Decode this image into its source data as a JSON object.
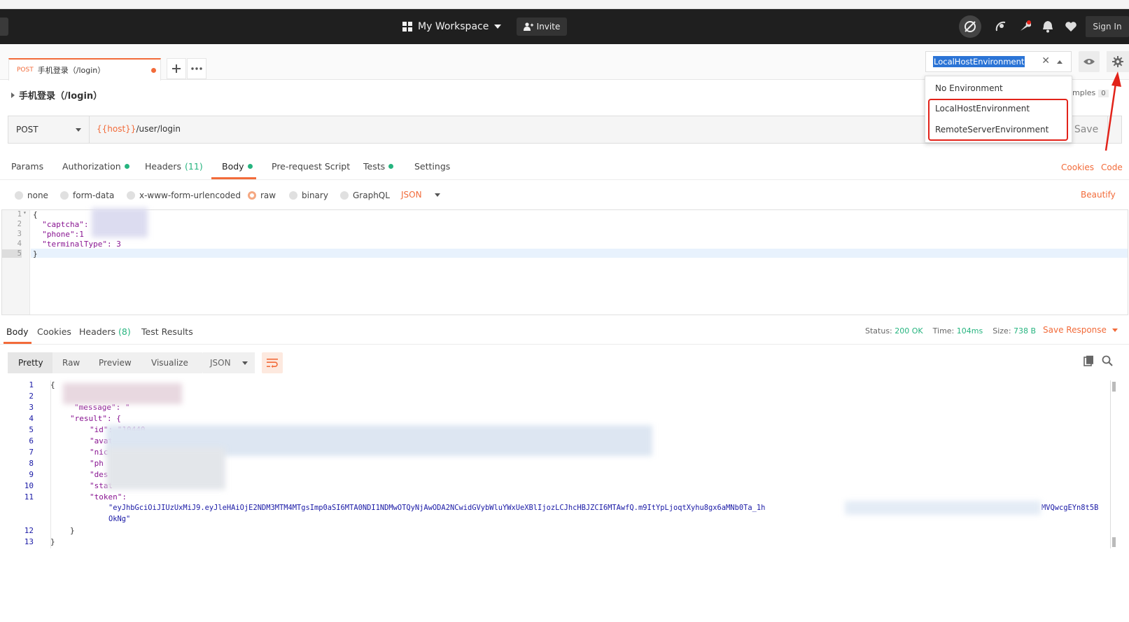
{
  "header": {
    "workspace_label": "My Workspace",
    "invite_label": "Invite",
    "signin_label": "Sign In"
  },
  "tab": {
    "method": "POST",
    "title": "手机登录（/login）"
  },
  "environment": {
    "selected": "LocalHostEnvironment",
    "options": [
      "No Environment",
      "LocalHostEnvironment",
      "RemoteServerEnvironment"
    ]
  },
  "request": {
    "name": "手机登录（/login）",
    "examples_label": "mples",
    "examples_count": "0",
    "method": "POST",
    "url_var": "{{host}}",
    "url_path": "/user/login",
    "save_label": "Save",
    "tabs": [
      "Params",
      "Authorization",
      "Headers",
      "Body",
      "Pre-request Script",
      "Tests",
      "Settings"
    ],
    "headers_count": "(11)",
    "cookies_label": "Cookies",
    "code_label": "Code",
    "body_types": [
      "none",
      "form-data",
      "x-www-form-urlencoded",
      "raw",
      "binary",
      "GraphQL"
    ],
    "body_format": "JSON",
    "beautify_label": "Beautify",
    "body_lines": [
      "1",
      "2",
      "3",
      "4",
      "5"
    ],
    "body_code": {
      "l1": "{",
      "l2": "  \"captcha\":",
      "l3": "  \"phone\":1",
      "l4": "  \"terminalType\": 3",
      "l5": "}"
    }
  },
  "response": {
    "tabs": [
      "Body",
      "Cookies",
      "Headers",
      "Test Results"
    ],
    "headers_count": "(8)",
    "status_label": "Status:",
    "status_value": "200 OK",
    "time_label": "Time:",
    "time_value": "104ms",
    "size_label": "Size:",
    "size_value": "738 B",
    "save_response_label": "Save Response",
    "view_modes": [
      "Pretty",
      "Raw",
      "Preview",
      "Visualize"
    ],
    "format": "JSON",
    "line_numbers": [
      "1",
      "2",
      "3",
      "4",
      "5",
      "6",
      "7",
      "8",
      "9",
      "10",
      "11",
      "12",
      "13"
    ],
    "code": {
      "open": "{",
      "message": "\"message\": \"",
      "result": "\"result\": {",
      "id": "\"id\": \"10440",
      "avatar": "\"avat",
      "nickname": "\"nic",
      "phone": "\"ph",
      "desc": "\"des",
      "status": "\"stat",
      "token_key": "\"token\":",
      "token_val_1": "\"eyJhbGciOiJIUzUxMiJ9.eyJleHAiOjE2NDM3MTM4MTgsImp0aSI6MTA0NDI1NDMwOTQyNjAwODA2NCwidGVybWluYWxUeXBlIjozLCJhcHBJZCI6MTAwfQ.m9ItYpLjoqtXyhu8gx6aMNb0Ta_1h",
      "token_val_1b": "MVQwcgEYn8t5B",
      "token_val_2": "OkNg\"",
      "close_inner": "}",
      "close_outer": "}"
    }
  }
}
